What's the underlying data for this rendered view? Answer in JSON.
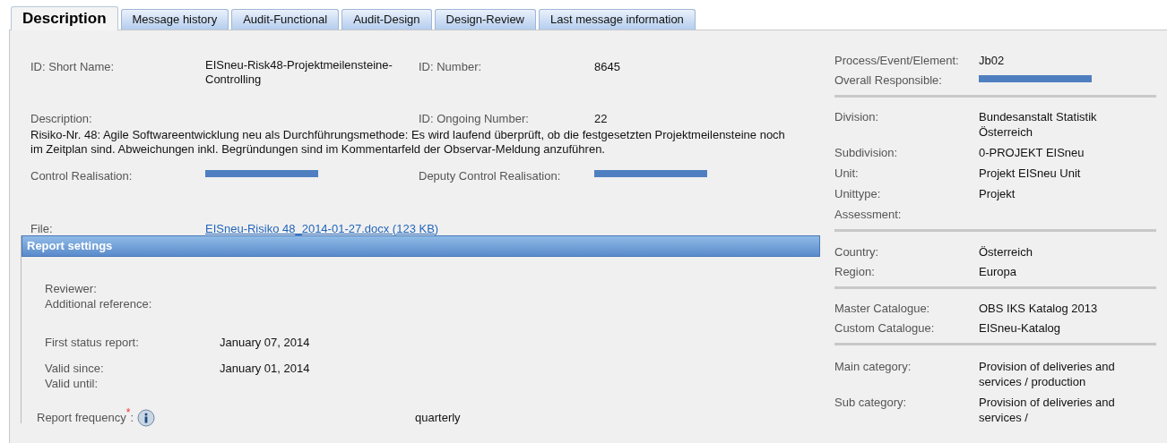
{
  "tabs": [
    {
      "label": "Description",
      "selected": true
    },
    {
      "label": "Message history",
      "selected": false
    },
    {
      "label": "Audit-Functional",
      "selected": false
    },
    {
      "label": "Audit-Design",
      "selected": false
    },
    {
      "label": "Design-Review",
      "selected": false
    },
    {
      "label": "Last message information",
      "selected": false
    }
  ],
  "details": {
    "short_name": {
      "label": "ID: Short Name:",
      "value": "EISneu-Risk48-Projektmeilensteine-Controlling"
    },
    "number": {
      "label": "ID: Number:",
      "value": "8645"
    },
    "description": {
      "label": "Description:",
      "value": "Risiko-Nr. 48: Agile Softwareentwicklung neu als Durchführungsmethode: Es wird laufend überprüft, ob die festgesetzten Projektmeilensteine noch im Zeitplan sind. Abweichungen inkl. Begründungen sind im Kommentarfeld der Observar-Meldung anzuführen."
    },
    "ongoing_number": {
      "label": "ID: Ongoing Number:",
      "value": "22"
    },
    "control_realisation": {
      "label": "Control Realisation:",
      "redacted": true
    },
    "deputy_control_realisation": {
      "label": "Deputy Control Realisation:",
      "redacted": true
    },
    "file": {
      "label": "File:",
      "link": "EISneu-Risiko 48_2014-01-27.docx (123 KB)"
    }
  },
  "report_settings": {
    "title": "Report settings",
    "rows": [
      {
        "label": "Reviewer:"
      },
      {
        "label": "Additional reference:"
      },
      {
        "label": "First status report:",
        "value": "January 07, 2014"
      },
      {
        "label": "Valid since:",
        "value": "January 01, 2014"
      },
      {
        "label": "Valid until:"
      }
    ],
    "frequency": {
      "label": "Report frequency$^{*}$:",
      "value": "quarterly"
    }
  },
  "side_groups": [
    {
      "rows": [
        {
          "label": "Process/Event/Element:",
          "value": "Jb02"
        },
        {
          "label": "Overall Responsible:",
          "redacted": true
        }
      ]
    },
    {
      "rows": [
        {
          "label": "Division:",
          "value": "Bundesanstalt Statistik Österreich"
        },
        {
          "label": "Subdivision:",
          "value": "0-PROJEKT EISneu"
        },
        {
          "label": "Unit:",
          "value": "Projekt EISneu Unit"
        },
        {
          "label": "Unittype:",
          "value": "Projekt"
        },
        {
          "label": "Assessment:"
        }
      ]
    },
    {
      "rows": [
        {
          "label": "Country:",
          "value": "Österreich"
        },
        {
          "label": "Region:",
          "value": "Europa"
        }
      ]
    },
    {
      "rows": [
        {
          "label": "Master Catalogue:",
          "value": "OBS IKS Katalog 2013"
        },
        {
          "label": "Custom Catalogue:",
          "value": "EISneu-Katalog"
        }
      ]
    },
    {
      "rows": [
        {
          "label": "Main category:",
          "value": "Provision of deliveries and services / production"
        },
        {
          "label": "Sub category:",
          "value": "Provision of deliveries and services /"
        }
      ]
    }
  ]
}
